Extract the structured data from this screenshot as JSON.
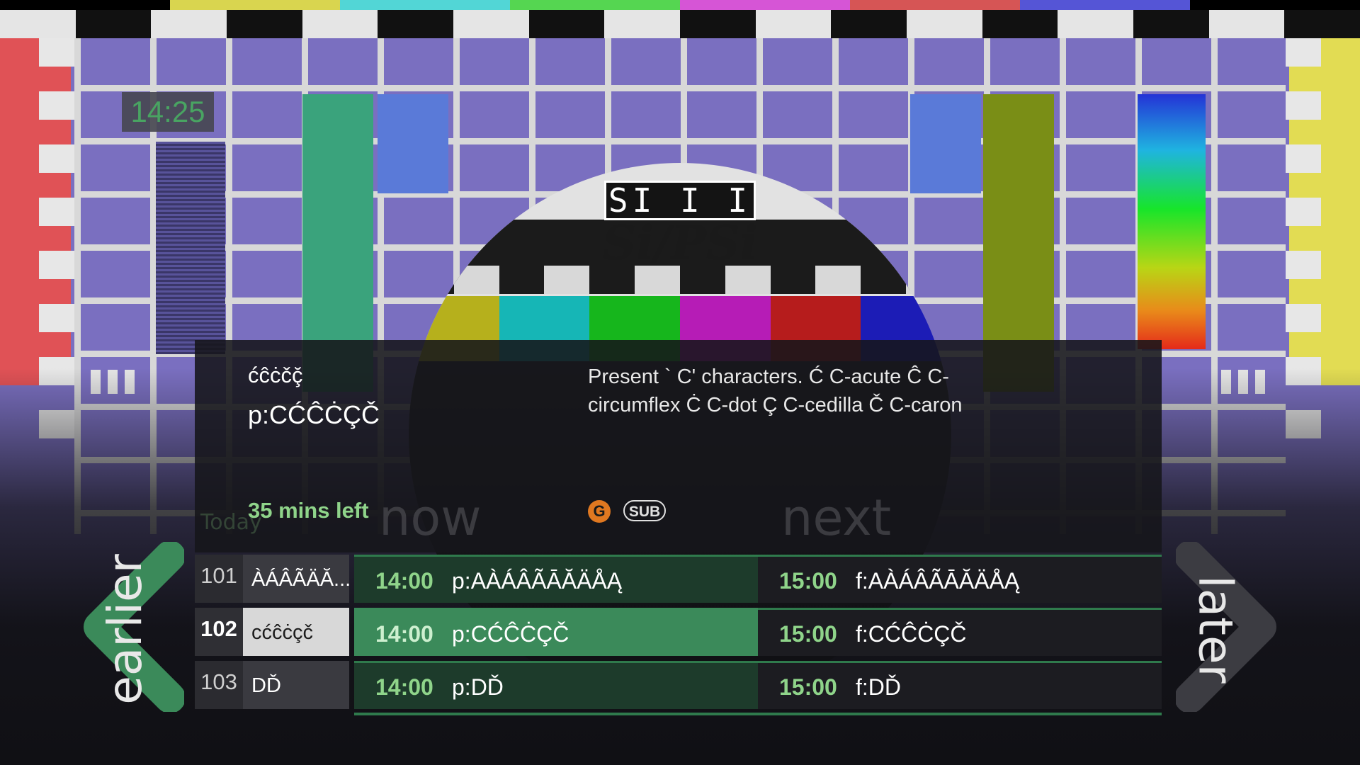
{
  "clock": "14:25",
  "testcard": {
    "logo_box": "SI I I",
    "logo_text": "Si/PSi"
  },
  "info": {
    "channel_name": "ćĉċčç̆",
    "programme_title": "p:CĆĈĊÇČ",
    "synopsis": "Present ` C' characters. Ć C-acute Ĉ C-circumflex Ċ C-dot Ç C-cedilla Č C-caron",
    "time_left": "35 mins left",
    "rating": "G",
    "subtitle_badge": "SUB"
  },
  "ghost": {
    "today": "Today",
    "now": "now",
    "next": "next"
  },
  "epg": {
    "rows": [
      {
        "num": "101",
        "name": "ÀÁÂÃÄĂ...",
        "now_time": "14:00",
        "now_title": "p:AÀÁÂÃĀĂÄÅĄ",
        "next_time": "15:00",
        "next_title": "f:AÀÁÂÃĀĂÄÅĄ"
      },
      {
        "num": "102",
        "name": "cćĉċçč",
        "now_time": "14:00",
        "now_title": "p:CĆĈĊÇČ",
        "next_time": "15:00",
        "next_title": "f:CĆĈĊÇČ"
      },
      {
        "num": "103",
        "name": "DĎ",
        "now_time": "14:00",
        "now_title": "p:DĎ",
        "next_time": "15:00",
        "next_title": "f:DĎ"
      }
    ]
  },
  "nav": {
    "earlier": "earlier",
    "later": "later"
  },
  "colors": {
    "accent_green": "#3b8a5a",
    "time_green": "#8fd48a",
    "rating_orange": "#e07820"
  }
}
